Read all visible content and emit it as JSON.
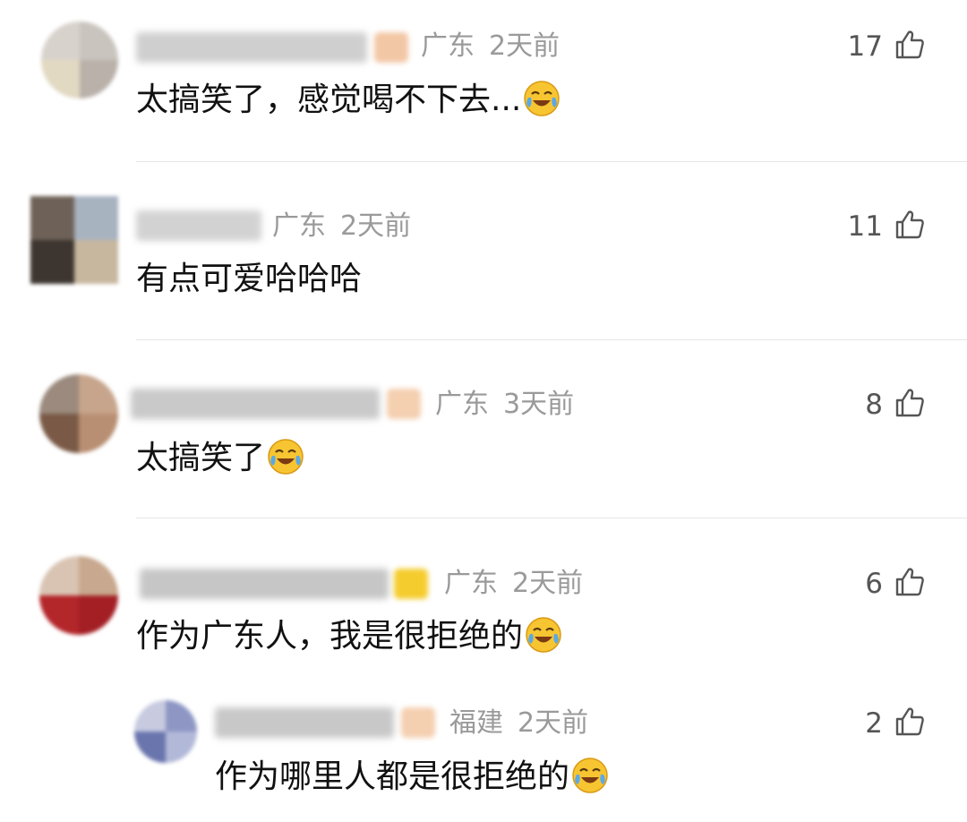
{
  "comments": [
    {
      "location": "广东",
      "time": "2天前",
      "text": "太搞笑了，感觉喝不下去...",
      "emoji": "laugh-cry-emoji",
      "likes": "17",
      "avatar_colors": [
        "#d8d2cc",
        "#c9c4be",
        "#e2d9c2",
        "#b9b1aa"
      ],
      "badge_color": "#f2c7a5"
    },
    {
      "location": "广东",
      "time": "2天前",
      "text": "有点可爱哈哈哈",
      "emoji": "",
      "likes": "11",
      "avatar_colors": [
        "#6e6258",
        "#a8b3c0",
        "#3d3530",
        "#c7b79f"
      ],
      "badge_color": ""
    },
    {
      "location": "广东",
      "time": "3天前",
      "text": "太搞笑了",
      "emoji": "laugh-cry-emoji",
      "likes": "8",
      "avatar_colors": [
        "#9b8a7d",
        "#c7a58c",
        "#7a5a46",
        "#b88f73"
      ],
      "badge_color": "#f4cfb0"
    },
    {
      "location": "广东",
      "time": "2天前",
      "text": "作为广东人，我是很拒绝的",
      "emoji": "laugh-cry-emoji",
      "likes": "6",
      "avatar_colors": [
        "#d9c4b3",
        "#b3262a",
        "#c8a88e",
        "#a31f24"
      ],
      "badge_color": "#f5cc2e"
    }
  ],
  "reply": {
    "location": "福建",
    "time": "2天前",
    "text": "作为哪里人都是很拒绝的",
    "emoji": "laugh-cry-emoji",
    "likes": "2",
    "avatar_colors": [
      "#8e97c4",
      "#c8cbe0",
      "#6a75ad",
      "#b2b8d8"
    ],
    "badge_color": "#f4cfb0"
  },
  "colors": {
    "meta": "#9a9a9a",
    "text": "#111111",
    "divider": "#e6e6e6",
    "emoji_face": "#f7c531",
    "emoji_tear": "#5aa9e6"
  }
}
